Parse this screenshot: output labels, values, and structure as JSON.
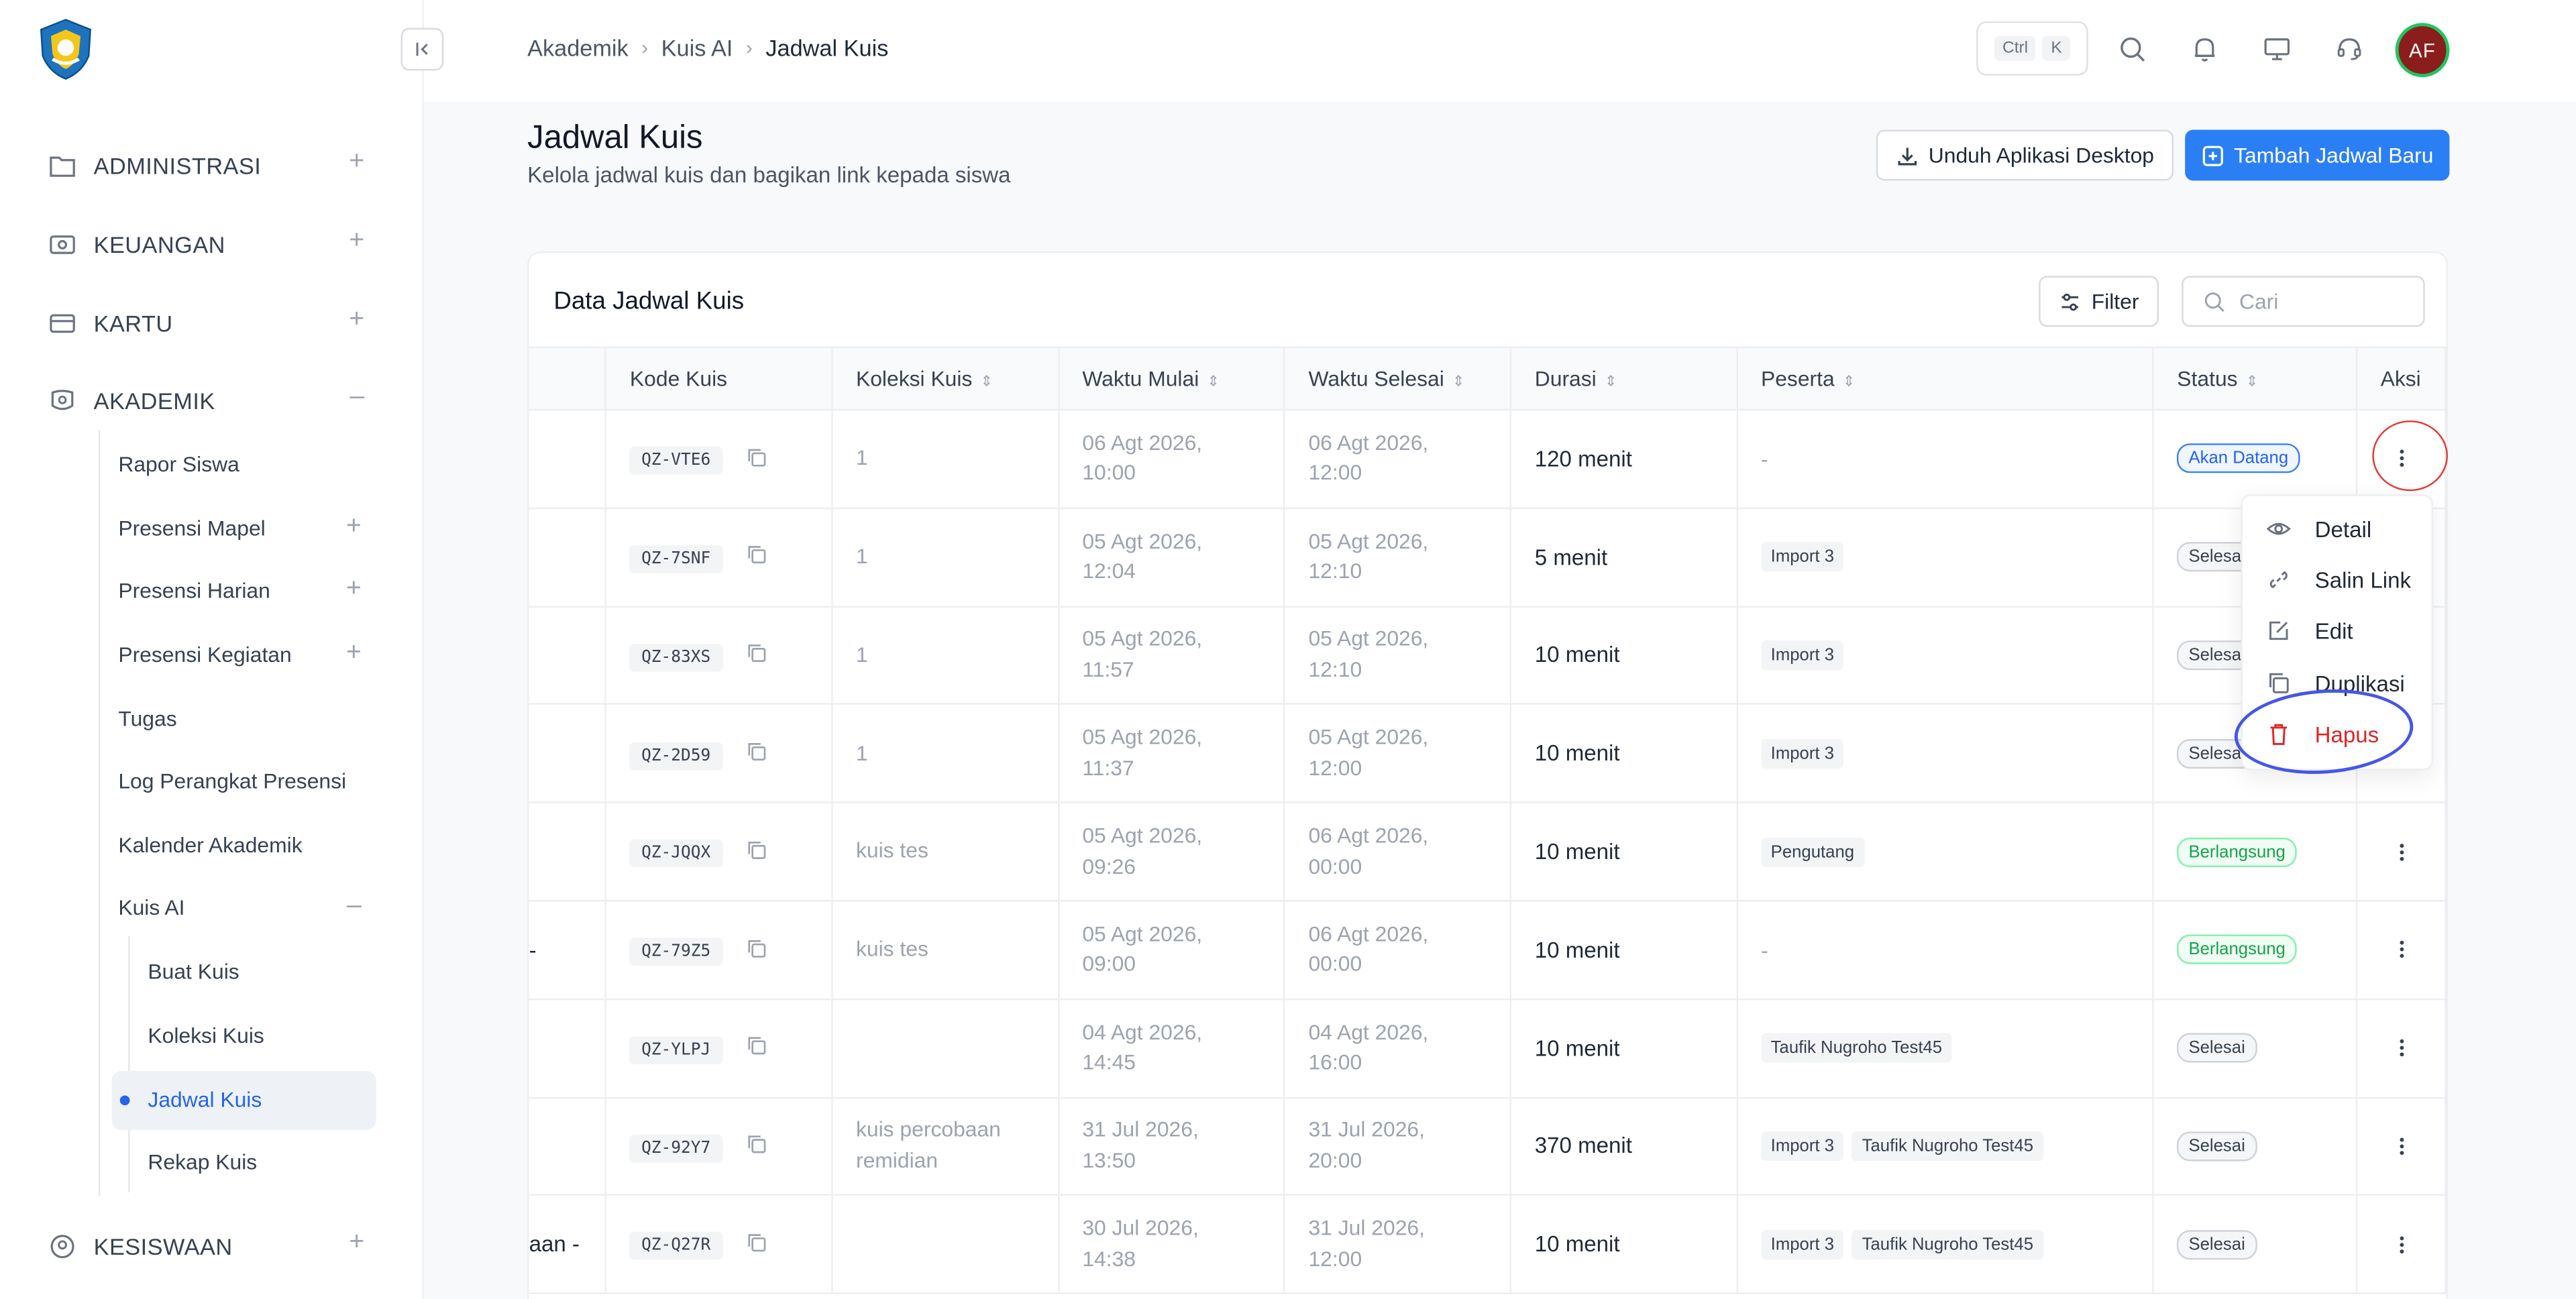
{
  "sidebar": {
    "groups": {
      "administrasi": "ADMINISTRASI",
      "keuangan": "KEUANGAN",
      "kartu": "KARTU",
      "akademik": "AKADEMIK",
      "kesiswaan": "KESISWAAN"
    },
    "akademik_items": {
      "rapor": "Rapor Siswa",
      "presensi_mapel": "Presensi Mapel",
      "presensi_harian": "Presensi Harian",
      "presensi_kegiatan": "Presensi Kegiatan",
      "tugas": "Tugas",
      "log_perangkat": "Log Perangkat Presensi",
      "kalender": "Kalender Akademik",
      "kuis_ai": "Kuis AI"
    },
    "kuis_items": {
      "buat": "Buat Kuis",
      "koleksi": "Koleksi Kuis",
      "jadwal": "Jadwal Kuis",
      "rekap": "Rekap Kuis"
    },
    "active_color": "#2563eb"
  },
  "topbar": {
    "breadcrumb": [
      "Akademik",
      "Kuis AI",
      "Jadwal Kuis"
    ],
    "kbd": [
      "Ctrl",
      "K"
    ],
    "avatar": "AF"
  },
  "header": {
    "title": "Jadwal Kuis",
    "subtitle": "Kelola jadwal kuis dan bagikan link kepada siswa",
    "download_btn": "Unduh Aplikasi Desktop",
    "add_btn": "Tambah Jadwal Baru"
  },
  "card": {
    "title": "Data Jadwal Kuis",
    "filter": "Filter",
    "search_placeholder": "Cari"
  },
  "table": {
    "columns": {
      "kode": "Kode Kuis",
      "koleksi": "Koleksi Kuis",
      "mulai": "Waktu Mulai",
      "selesai": "Waktu Selesai",
      "durasi": "Durasi",
      "peserta": "Peserta",
      "status": "Status",
      "aksi": "Aksi"
    },
    "rows": [
      {
        "left": "",
        "kode": "QZ-VTE6",
        "koleksi": "1",
        "mulai": [
          "06 Agt 2026,",
          "10:00"
        ],
        "selesai": [
          "06 Agt 2026,",
          "12:00"
        ],
        "durasi": "120 menit",
        "peserta_text": "-",
        "peserta": [],
        "status": "Akan Datang",
        "status_type": "blue"
      },
      {
        "left": "",
        "kode": "QZ-7SNF",
        "koleksi": "1",
        "mulai": [
          "05 Agt 2026,",
          "12:04"
        ],
        "selesai": [
          "05 Agt 2026,",
          "12:10"
        ],
        "durasi": "5 menit",
        "peserta_text": "",
        "peserta": [
          "Import 3"
        ],
        "status": "Selesai",
        "status_type": "gray"
      },
      {
        "left": "",
        "kode": "QZ-83XS",
        "koleksi": "1",
        "mulai": [
          "05 Agt 2026,",
          "11:57"
        ],
        "selesai": [
          "05 Agt 2026,",
          "12:10"
        ],
        "durasi": "10 menit",
        "peserta_text": "",
        "peserta": [
          "Import 3"
        ],
        "status": "Selesai",
        "status_type": "gray"
      },
      {
        "left": "",
        "kode": "QZ-2D59",
        "koleksi": "1",
        "mulai": [
          "05 Agt 2026,",
          "11:37"
        ],
        "selesai": [
          "05 Agt 2026,",
          "12:00"
        ],
        "durasi": "10 menit",
        "peserta_text": "",
        "peserta": [
          "Import 3"
        ],
        "status": "Selesai",
        "status_type": "gray"
      },
      {
        "left": "",
        "kode": "QZ-JQQX",
        "koleksi": "kuis tes",
        "mulai": [
          "05 Agt 2026,",
          "09:26"
        ],
        "selesai": [
          "06 Agt 2026,",
          "00:00"
        ],
        "durasi": "10 menit",
        "peserta_text": "",
        "peserta": [
          "Pengutang"
        ],
        "status": "Berlangsung",
        "status_type": "green"
      },
      {
        "left": "-",
        "kode": "QZ-79Z5",
        "koleksi": "kuis tes",
        "mulai": [
          "05 Agt 2026,",
          "09:00"
        ],
        "selesai": [
          "06 Agt 2026,",
          "00:00"
        ],
        "durasi": "10 menit",
        "peserta_text": "-",
        "peserta": [],
        "status": "Berlangsung",
        "status_type": "green"
      },
      {
        "left": "",
        "kode": "QZ-YLPJ",
        "koleksi": "",
        "mulai": [
          "04 Agt 2026,",
          "14:45"
        ],
        "selesai": [
          "04 Agt 2026,",
          "16:00"
        ],
        "durasi": "10 menit",
        "peserta_text": "",
        "peserta": [
          "Taufik Nugroho Test45"
        ],
        "status": "Selesai",
        "status_type": "gray"
      },
      {
        "left": "",
        "kode": "QZ-92Y7",
        "koleksi": "kuis percobaan\nremidian",
        "mulai": [
          "31 Jul 2026,",
          "13:50"
        ],
        "selesai": [
          "31 Jul 2026,",
          "20:00"
        ],
        "durasi": "370 menit",
        "peserta_text": "",
        "peserta": [
          "Import 3",
          "Taufik Nugroho Test45"
        ],
        "status": "Selesai",
        "status_type": "gray"
      },
      {
        "left": "aan -",
        "kode": "QZ-Q27R",
        "koleksi": "",
        "mulai": [
          "30 Jul 2026,",
          "14:38"
        ],
        "selesai": [
          "31 Jul 2026,",
          "12:00"
        ],
        "durasi": "10 menit",
        "peserta_text": "",
        "peserta": [
          "Import 3",
          "Taufik Nugroho Test45"
        ],
        "status": "Selesai",
        "status_type": "gray"
      }
    ]
  },
  "action_menu": {
    "detail": "Detail",
    "salin": "Salin Link",
    "edit": "Edit",
    "duplikasi": "Duplikasi",
    "hapus": "Hapus"
  },
  "colors": {
    "primary": "#2b7ff5",
    "danger": "#dc2626",
    "annotation_red": "#e53935",
    "annotation_blue": "#4656e8"
  }
}
